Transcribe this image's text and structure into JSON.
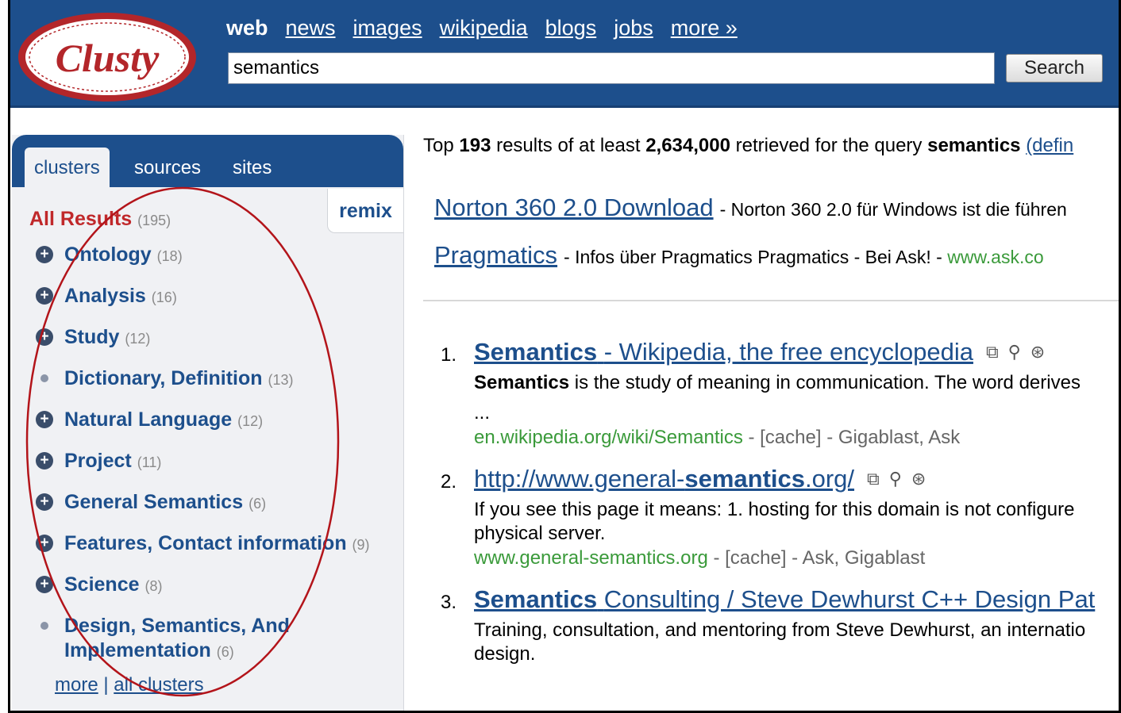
{
  "header": {
    "logo_text": "Clusty",
    "nav": [
      "web",
      "news",
      "images",
      "wikipedia",
      "blogs",
      "jobs",
      "more »"
    ],
    "query": "semantics",
    "search_button": "Search"
  },
  "sidebar": {
    "tabs": [
      "clusters",
      "sources",
      "sites"
    ],
    "remix": "remix",
    "all_results": {
      "label": "All Results",
      "count": "(195)"
    },
    "clusters": [
      {
        "label": "Ontology",
        "count": "(18)",
        "expandable": true
      },
      {
        "label": "Analysis",
        "count": "(16)",
        "expandable": true
      },
      {
        "label": "Study",
        "count": "(12)",
        "expandable": true
      },
      {
        "label": "Dictionary, Definition",
        "count": "(13)",
        "expandable": false
      },
      {
        "label": "Natural Language",
        "count": "(12)",
        "expandable": true
      },
      {
        "label": "Project",
        "count": "(11)",
        "expandable": true
      },
      {
        "label": "General Semantics",
        "count": "(6)",
        "expandable": true
      },
      {
        "label": "Features, Contact information",
        "count": "(9)",
        "expandable": true
      },
      {
        "label": "Science",
        "count": "(8)",
        "expandable": true
      },
      {
        "label": "Design, Semantics, And Implementation",
        "count": "(6)",
        "expandable": false
      }
    ],
    "more": "more",
    "all_clusters": "all clusters"
  },
  "summary": {
    "prefix": "Top",
    "top_count": "193",
    "middle": "results of at least",
    "total": "2,634,000",
    "suffix": "retrieved for the query",
    "query": "semantics",
    "def_link": "(defin"
  },
  "sponsored": [
    {
      "title": "Norton 360 2.0 Download",
      "desc": "- Norton 360 2.0 für Windows ist die führen",
      "url": ""
    },
    {
      "title": "Pragmatics",
      "desc": "- Infos über Pragmatics Pragmatics - Bei Ask! -",
      "url": "www.ask.co"
    }
  ],
  "results": [
    {
      "num": "1.",
      "title_bold": "Semantics",
      "title_rest": "- Wikipedia, the free encyclopedia",
      "snippet_bold": "Semantics",
      "snippet": "is the study of meaning in communication. The word derives",
      "snippet2": "...",
      "url": "en.wikipedia.org/wiki/Semantics",
      "cache": "[cache]",
      "sources": "Gigablast, Ask"
    },
    {
      "num": "2.",
      "title_pre": "http://www.general-",
      "title_bold": "semantics",
      "title_post": ".org/",
      "snippet": "If you see this page it means: 1. hosting for this domain is not configure",
      "snippet2": "physical server.",
      "url": "www.general-semantics.org",
      "cache": "[cache]",
      "sources": "Ask, Gigablast"
    },
    {
      "num": "3.",
      "title_bold": "Semantics",
      "title_rest": "Consulting / Steve Dewhurst C++ Design Pat",
      "snippet": "Training, consultation, and mentoring from Steve Dewhurst, an internatio",
      "snippet2": "design."
    }
  ],
  "icons": [
    "new-window-icon",
    "preview-magnifier-icon",
    "clusters-icon"
  ],
  "colors": {
    "brand_blue": "#1d4f8c",
    "logo_red": "#c0282a",
    "url_green": "#3a9a3a"
  }
}
